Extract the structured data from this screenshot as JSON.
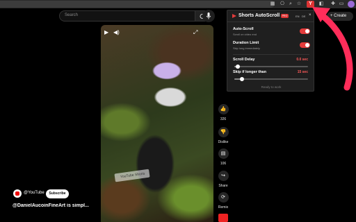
{
  "browser": {
    "active_extension_letter": "Y",
    "icons": [
      "apps-icon",
      "translate-icon",
      "zoom-icon",
      "bookmark-star-icon",
      "extension-icon",
      "puzzle-icon",
      "sidebar-icon"
    ],
    "profile_color": "#9b6ad6"
  },
  "youtube": {
    "search_placeholder": "Search",
    "create_label": "+ Create",
    "channel_handle": "@YouTube",
    "subscribe_label": "Subscribe",
    "video_title": "@DanielAucoinFineArt is simpl...",
    "watermark": "YouTube Shorts",
    "actions": [
      {
        "icon": "like-icon",
        "label": "326"
      },
      {
        "icon": "dislike-icon",
        "label": "Dislike"
      },
      {
        "icon": "comment-icon",
        "label": "106"
      },
      {
        "icon": "share-icon",
        "label": "Share"
      },
      {
        "icon": "remix-icon",
        "label": "Remix"
      }
    ]
  },
  "popup": {
    "title": "Shorts AutoScroll",
    "badge": "PRO",
    "languages": [
      "EN",
      "DE"
    ],
    "close_glyph": "×",
    "auto_scroll": {
      "title": "Auto-Scroll",
      "desc": "Scroll on video end",
      "enabled": true
    },
    "duration_limit": {
      "title": "Duration Limit",
      "desc": "Skip long immediately",
      "enabled": true
    },
    "scroll_delay": {
      "title": "Scroll Delay",
      "value": "0.0 sec",
      "fraction": 0.05
    },
    "skip_longer": {
      "title": "Skip if longer than",
      "value": "15 sec",
      "fraction": 0.1
    },
    "footer": "Ready to work",
    "accent": "#e43b3b"
  },
  "arrow_color": "#ff2d5a"
}
